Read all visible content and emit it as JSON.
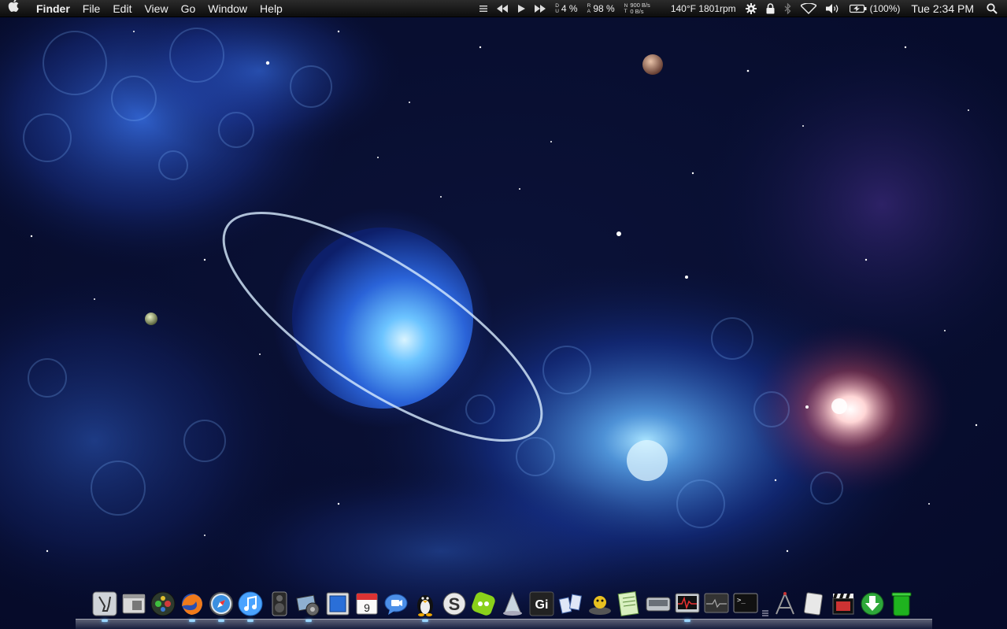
{
  "menubar": {
    "apple_menu": "apple-logo-icon",
    "app_name": "Finder",
    "menus": [
      "File",
      "Edit",
      "View",
      "Go",
      "Window",
      "Help"
    ],
    "status": {
      "cpu_label_top": "D",
      "cpu_label_bottom": "U",
      "cpu": "4 %",
      "mem_label_top": "R",
      "mem_label_bottom": "A",
      "memory": "98 %",
      "net_label_top": "N",
      "net_label_bottom": "T",
      "net_in": "900 B/s",
      "net_out": "0 B/s",
      "temp_fan": "140°F 1801rpm",
      "battery": "(100%)",
      "clock": "Tue 2:34 PM"
    }
  },
  "dock": {
    "items": [
      {
        "name": "system-preferences-icon"
      },
      {
        "name": "finder-window-icon"
      },
      {
        "name": "game-controller-icon"
      },
      {
        "name": "firefox-icon"
      },
      {
        "name": "safari-compass-icon"
      },
      {
        "name": "itunes-icon"
      },
      {
        "name": "speaker-icon"
      },
      {
        "name": "iphoto-icon"
      },
      {
        "name": "preview-window-icon"
      },
      {
        "name": "ical-icon",
        "text": "9"
      },
      {
        "name": "ichat-icon"
      },
      {
        "name": "tux-penguin-icon"
      },
      {
        "name": "skype-icon",
        "text": "S"
      },
      {
        "name": "green-app-icon"
      },
      {
        "name": "vlc-cone-icon"
      },
      {
        "name": "gi-app-icon",
        "text": "Gi"
      },
      {
        "name": "growl-notes-icon"
      },
      {
        "name": "yellow-character-icon"
      },
      {
        "name": "textedit-icon"
      },
      {
        "name": "hard-drive-icon"
      },
      {
        "name": "activity-monitor-icon"
      },
      {
        "name": "console-icon"
      },
      {
        "name": "terminal-icon",
        "text": ">_"
      },
      {
        "name": "dock-separator-icon"
      },
      {
        "name": "applications-stack-icon"
      },
      {
        "name": "documents-stack-icon"
      },
      {
        "name": "movie-clapper-icon"
      },
      {
        "name": "downloads-arrow-icon"
      },
      {
        "name": "trash-icon"
      }
    ]
  },
  "colors": {
    "menubar": "#151515",
    "planet": "#4fa6ff",
    "space": "#0a1544",
    "nebula": "#2b5fd6"
  }
}
